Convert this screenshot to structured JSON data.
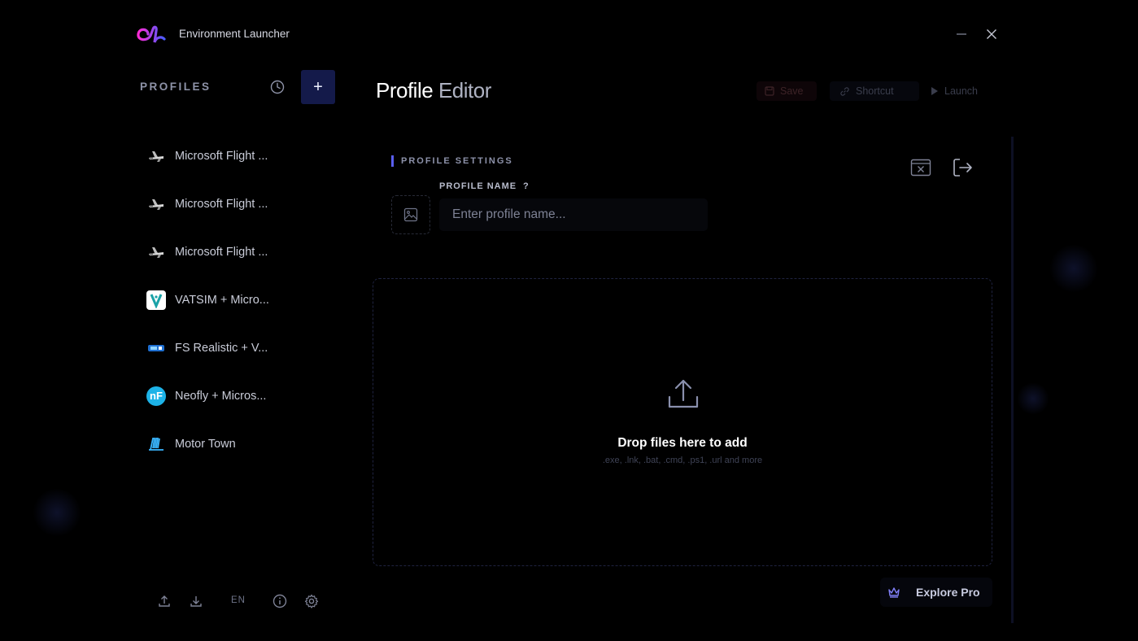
{
  "window": {
    "title": "Environment Launcher",
    "minimize_icon": "minimize-icon",
    "close_icon": "close-icon"
  },
  "sidebar": {
    "header": "PROFILES",
    "history_icon": "clock-icon",
    "add_label": "+",
    "profiles": [
      {
        "label": "Microsoft Flight ...",
        "icon": "airliner-icon"
      },
      {
        "label": "Microsoft Flight ...",
        "icon": "airliner-icon"
      },
      {
        "label": "Microsoft Flight ...",
        "icon": "airliner-icon"
      },
      {
        "label": "VATSIM + Micro...",
        "icon": "vatsim-logo-icon"
      },
      {
        "label": "FS Realistic + V...",
        "icon": "fs-realistic-icon"
      },
      {
        "label": "Neofly + Micros...",
        "icon": "neofly-logo-icon"
      },
      {
        "label": "Motor Town",
        "icon": "motor-town-icon"
      }
    ],
    "footer": {
      "export_icon": "upload-icon",
      "import_icon": "download-icon",
      "language": "EN",
      "info_icon": "info-icon",
      "settings_icon": "gear-icon"
    }
  },
  "editor": {
    "title_bold": "Profile",
    "title_light": "Editor",
    "toolbar": {
      "save_label": "Save",
      "shortcut_label": "Shortcut",
      "launch_label": "Launch"
    },
    "settings_header": "PROFILE SETTINGS",
    "profile_name_label": "PROFILE NAME",
    "help_label": "?",
    "profile_name_value": "",
    "profile_name_placeholder": "Enter profile name...",
    "dropzone": {
      "title": "Drop files here to add",
      "subtitle": ".exe, .lnk, .bat, .cmd, .ps1, .url and more"
    },
    "explore_pro_label": "Explore Pro"
  },
  "colors": {
    "background": "#000000",
    "accent": "#5a5ef0",
    "add_button_bg": "#141a4a",
    "logo_gradient_start": "#ff2bd6",
    "logo_gradient_end": "#4a5cff"
  }
}
